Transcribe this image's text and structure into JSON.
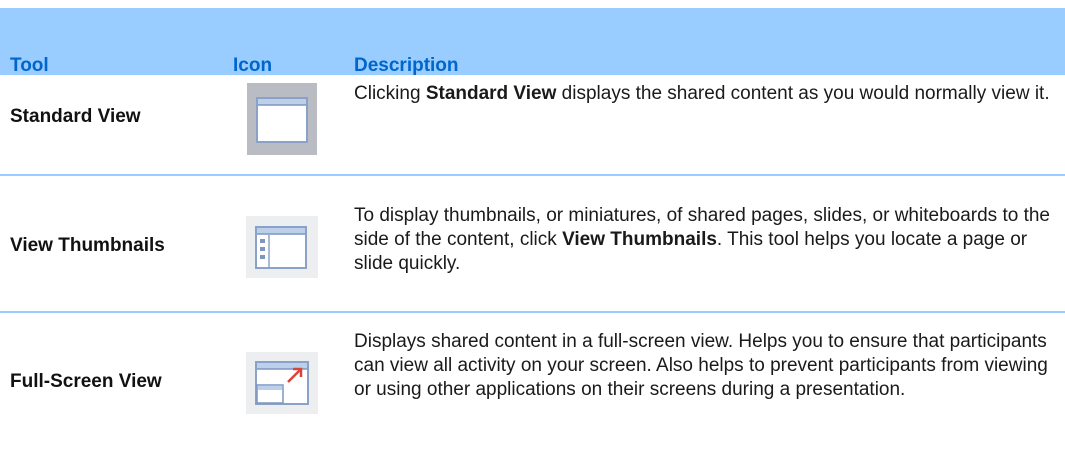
{
  "table": {
    "headers": {
      "tool": "Tool",
      "icon": "Icon",
      "description": "Description"
    },
    "rows": [
      {
        "tool": "Standard View",
        "icon": "standard-view-icon",
        "description": {
          "pre": "Clicking ",
          "bold": "Standard View",
          "post": " displays the shared content as you would normally view it."
        }
      },
      {
        "tool": "View Thumbnails",
        "icon": "view-thumbnails-icon",
        "description": {
          "pre": "To display thumbnails, or miniatures, of shared pages, slides, or whiteboards to the side of the content, click ",
          "bold": "View Thumbnails",
          "post": ". This tool helps you locate a page or slide quickly."
        }
      },
      {
        "tool": "Full-Screen View",
        "icon": "full-screen-view-icon",
        "description": {
          "pre": "Displays shared content in a full-screen view. Helps you to ensure that participants can view all activity on your screen. Also helps to prevent participants from viewing or using other applications on their screens during a presentation.",
          "bold": "",
          "post": ""
        }
      }
    ]
  },
  "colors": {
    "header_band": "#99ccff",
    "header_text": "#0066cc",
    "divider": "#99ccff"
  }
}
